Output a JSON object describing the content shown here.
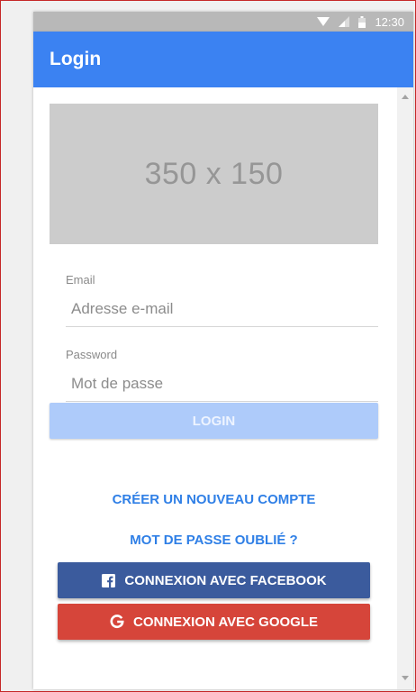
{
  "status_bar": {
    "time": "12:30",
    "icons": [
      "wifi-icon",
      "signal-icon",
      "battery-icon"
    ]
  },
  "app_bar": {
    "title": "Login",
    "color": "#3b82f2"
  },
  "hero_image": {
    "label": "350 x 150"
  },
  "form": {
    "email": {
      "label": "Email",
      "placeholder": "Adresse e-mail",
      "value": ""
    },
    "password": {
      "label": "Password",
      "placeholder": "Mot de passe",
      "value": ""
    },
    "login_label": "LOGIN"
  },
  "links": {
    "create_account": "CRÉER UN NOUVEAU COMPTE",
    "forgot_password": "MOT DE PASSE OUBLIÉ ?"
  },
  "social": {
    "facebook": {
      "label": "CONNEXION AVEC FACEBOOK",
      "icon": "facebook-icon",
      "color": "#3b5b9d"
    },
    "google": {
      "label": "CONNEXION AVEC GOOGLE",
      "icon": "google-icon",
      "color": "#d6453a"
    }
  }
}
